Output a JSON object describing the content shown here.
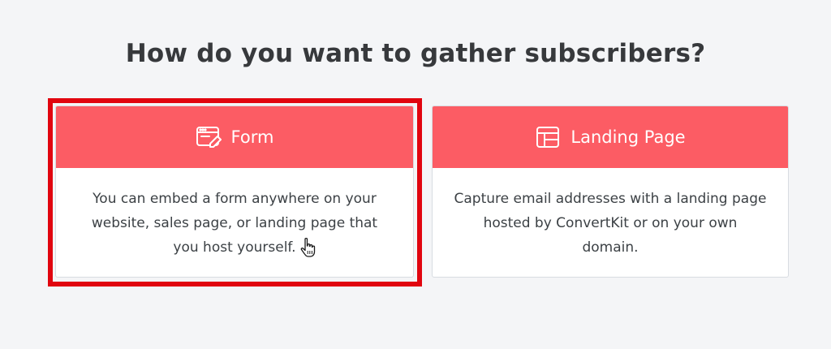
{
  "page": {
    "title": "How do you want to gather subscribers?"
  },
  "options": [
    {
      "label": "Form",
      "icon": "form-icon",
      "description": "You can embed a form anywhere on your website, sales page, or landing page that you host yourself.",
      "selected": true
    },
    {
      "label": "Landing Page",
      "icon": "landing-page-icon",
      "description": "Capture email addresses with a landing page hosted by ConvertKit or on your own domain.",
      "selected": false
    }
  ],
  "colors": {
    "header": "#fc5c64",
    "selection_frame": "#e1050f",
    "background": "#f4f5f7",
    "title_text": "#37393c"
  }
}
